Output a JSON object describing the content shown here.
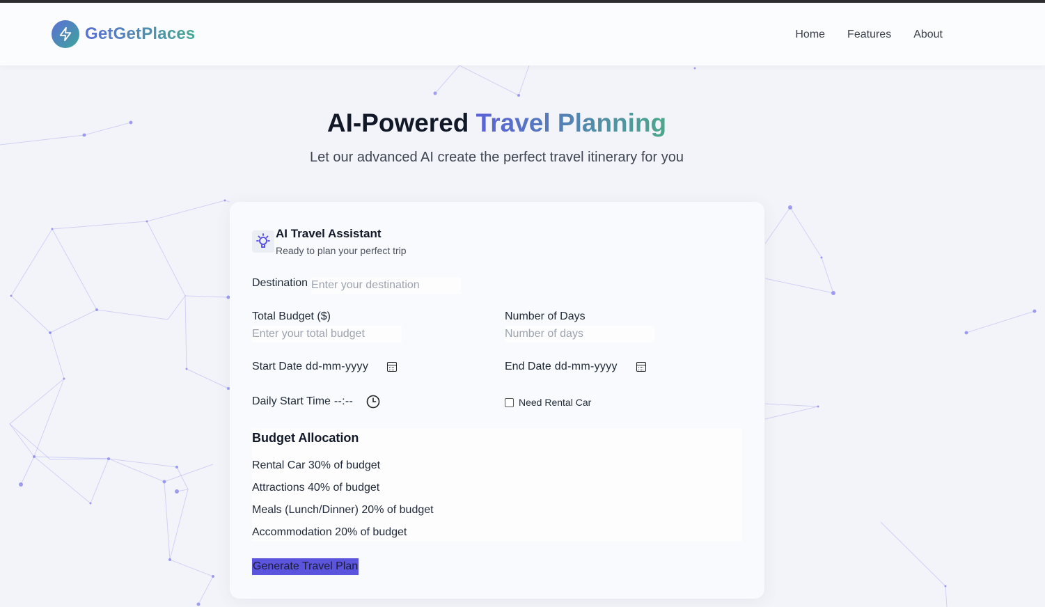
{
  "header": {
    "brand": "GetGetPlaces",
    "nav": [
      "Home",
      "Features",
      "About"
    ]
  },
  "hero": {
    "title_plain": "AI-Powered ",
    "title_highlight": "Travel Planning",
    "subtitle": "Let our advanced AI create the perfect travel itinerary for you"
  },
  "assistant": {
    "title": "AI Travel Assistant",
    "subtitle": "Ready to plan your perfect trip"
  },
  "form": {
    "destination_label": "Destination",
    "destination_placeholder": "Enter your destination",
    "budget_label": "Total Budget ($)",
    "budget_placeholder": "Enter your total budget",
    "days_label": "Number of Days",
    "days_placeholder": "Number of days",
    "start_date_label": "Start Date",
    "start_date_value": "dd-mm-yyyy",
    "end_date_label": "End Date",
    "end_date_value": "dd-mm-yyyy",
    "start_time_label": "Daily Start Time",
    "start_time_value": "--:--",
    "rental_label": "Need Rental Car",
    "rental_checked": false
  },
  "budget_allocation": {
    "title": "Budget Allocation",
    "items": [
      "Rental Car 30% of budget",
      "Attractions 40% of budget",
      "Meals (Lunch/Dinner) 20% of budget",
      "Accommodation 20% of budget"
    ]
  },
  "actions": {
    "generate": "Generate Travel Plan"
  },
  "colors": {
    "brand_start": "#5b6fd6",
    "brand_end": "#3ea59a",
    "button_bg": "#5a55dc",
    "network": "#7b7be8"
  }
}
